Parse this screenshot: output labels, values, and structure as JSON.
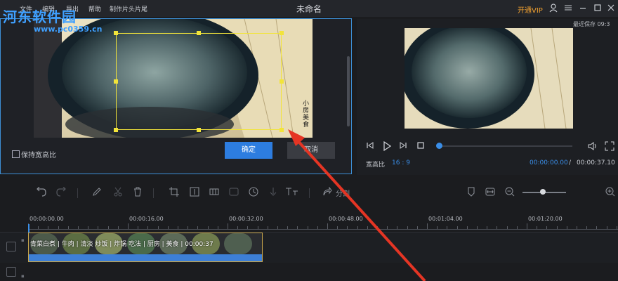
{
  "watermark": {
    "line1": "河东软件园",
    "line2": "www.pc0359.cn"
  },
  "titlebar": {
    "menu": [
      "文件",
      "编辑",
      "导出",
      "帮助",
      "制作片头片尾"
    ],
    "title": "未命名",
    "vip_label": "开通VIP"
  },
  "crop": {
    "keep_ratio_label": "保持宽高比",
    "confirm_label": "确定",
    "cancel_label": "取消",
    "video_caption": "小房美食"
  },
  "preview": {
    "autosave_label": "最近保存 09:3",
    "ratio_label": "宽高比",
    "ratio_value": "16 : 9",
    "time_current": "00:00:00.00",
    "time_separator": "/",
    "time_total": "00:00:37.10",
    "progress": 0.0
  },
  "toolbar": {
    "split_label": "分割"
  },
  "timeline": {
    "ticks": [
      "00:00:00.00",
      "00:00:16.00",
      "00:00:32.00",
      "00:00:48.00",
      "00:01:04.00",
      "00:01:20.00"
    ],
    "clip_title": "青菜白煮 | 牛肉 | 清淡 炒饭 | 炸锅 吃法 | 厨房 | 美食 | 00:00:37"
  },
  "colors": {
    "accent": "#2d7de0",
    "crop_frame": "#f2e43a",
    "arrow": "#e53524",
    "clip_border": "#c9a64a"
  },
  "icons": [
    "undo-icon",
    "redo-icon",
    "pen-icon",
    "scissors-icon",
    "trash-icon",
    "crop-icon",
    "resize-icon",
    "mosaic-icon",
    "freeze-icon",
    "speed-icon",
    "audio-icon",
    "text-icon",
    "split-icon",
    "marker-icon",
    "fit-icon",
    "zoom-out-icon",
    "zoom-in-icon",
    "user-icon",
    "menu-icon",
    "minimize-icon",
    "maximize-icon",
    "close-icon"
  ]
}
